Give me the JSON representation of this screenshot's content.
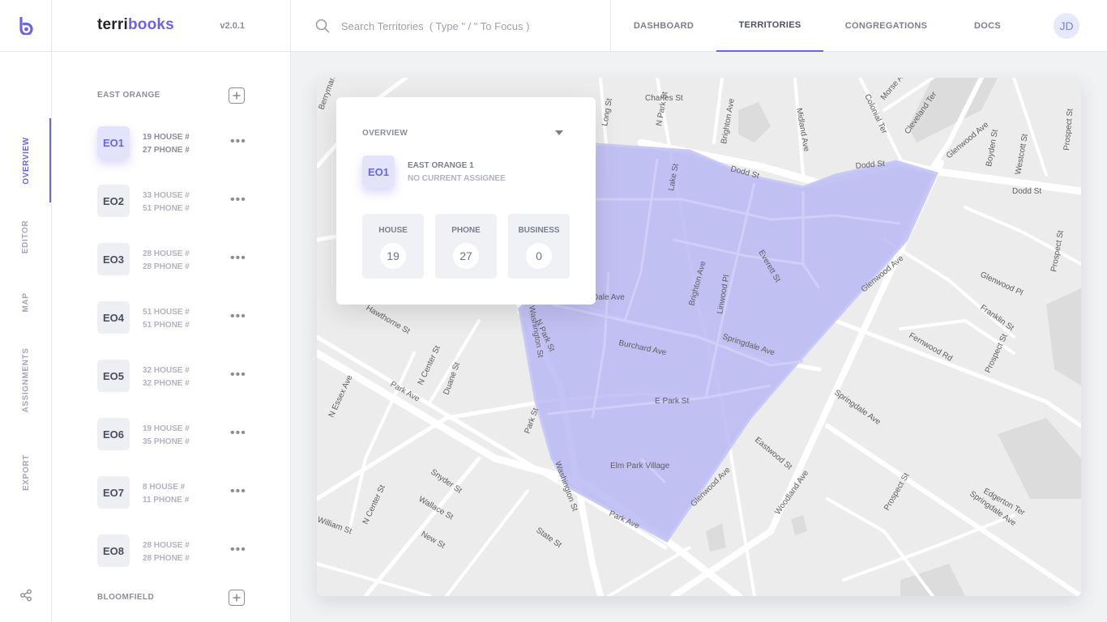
{
  "brand": {
    "part1": "terri",
    "part2": "books",
    "version": "v2.0.1"
  },
  "search": {
    "placeholder": "Search Territories  ( Type \" / \" To Focus )"
  },
  "nav": {
    "tabs": [
      {
        "label": "DASHBOARD",
        "active": false
      },
      {
        "label": "TERRITORIES",
        "active": true
      },
      {
        "label": "CONGREGATIONS",
        "active": false
      },
      {
        "label": "DOCS",
        "active": false
      }
    ]
  },
  "user": {
    "initials": "JD"
  },
  "rail": {
    "items": [
      {
        "label": "OVERVIEW",
        "active": true
      },
      {
        "label": "EDITOR",
        "active": false
      },
      {
        "label": "MAP",
        "active": false
      },
      {
        "label": "ASSIGNMENTS",
        "active": false
      },
      {
        "label": "EXPORT",
        "active": false
      }
    ]
  },
  "groups": [
    {
      "name": "EAST ORANGE"
    },
    {
      "name": "BLOOMFIELD"
    }
  ],
  "territories": [
    {
      "code": "EO1",
      "house": "19 HOUSE #",
      "phone": "27 PHONE #",
      "active": true
    },
    {
      "code": "EO2",
      "house": "33 HOUSE #",
      "phone": "51 PHONE #",
      "active": false
    },
    {
      "code": "EO3",
      "house": "28 HOUSE #",
      "phone": "28 PHONE #",
      "active": false
    },
    {
      "code": "EO4",
      "house": "51 HOUSE #",
      "phone": "51 PHONE #",
      "active": false
    },
    {
      "code": "EO5",
      "house": "32 HOUSE #",
      "phone": "32 PHONE #",
      "active": false
    },
    {
      "code": "EO6",
      "house": "19 HOUSE #",
      "phone": "35 PHONE #",
      "active": false
    },
    {
      "code": "EO7",
      "house": "8 HOUSE #",
      "phone": "11 PHONE #",
      "active": false
    },
    {
      "code": "EO8",
      "house": "28 HOUSE #",
      "phone": "28 PHONE #",
      "active": false
    }
  ],
  "overview": {
    "title": "OVERVIEW",
    "code": "EO1",
    "name": "EAST ORANGE 1",
    "assignee": "NO CURRENT ASSIGNEE",
    "stats": [
      {
        "label": "HOUSE",
        "value": "19"
      },
      {
        "label": "PHONE",
        "value": "27"
      },
      {
        "label": "BUSINESS",
        "value": "0"
      }
    ]
  },
  "map": {
    "streets": [
      "Berryman Pl",
      "Charles St",
      "Long St",
      "N Park St",
      "Brighton Ave",
      "Midland Ave",
      "Morse Ave",
      "Colonial Ter",
      "Cleveland Ter",
      "Glenwood Ave",
      "Boyden St",
      "Westcott St",
      "Prospect St",
      "Dodd St",
      "Dodd St",
      "Dodd St",
      "Lake St",
      "Everett St",
      "Brighton Ave",
      "Linwood Pl",
      "Glenwood Ave",
      "Glenwood Pl",
      "Franklin St",
      "Prospect St",
      "Fernwood Rd",
      "Prospect St",
      "Dale Ave",
      "Washington St",
      "N Park St",
      "Burchard Ave",
      "Springdale Ave",
      "E Park St",
      "Springdale Ave",
      "Eastwood St",
      "Elm Park Village",
      "Park St",
      "Washington St",
      "Glenwood Ave",
      "Park Ave",
      "Woodland Ave",
      "Prospect St",
      "Edgerton Ter",
      "Springdale Ave",
      "Hawthorne St",
      "N Center St",
      "Duane St",
      "Park Ave",
      "N Essex Ave",
      "Snyder St",
      "Wallace St",
      "N Center St",
      "New St",
      "State St",
      "William St"
    ],
    "colors": {
      "territory_fill": "#b7b6f4",
      "territory_stroke": "#c6c6f5",
      "road": "#ffffff",
      "land": "#ececec",
      "accent": "#6b63e0"
    }
  }
}
